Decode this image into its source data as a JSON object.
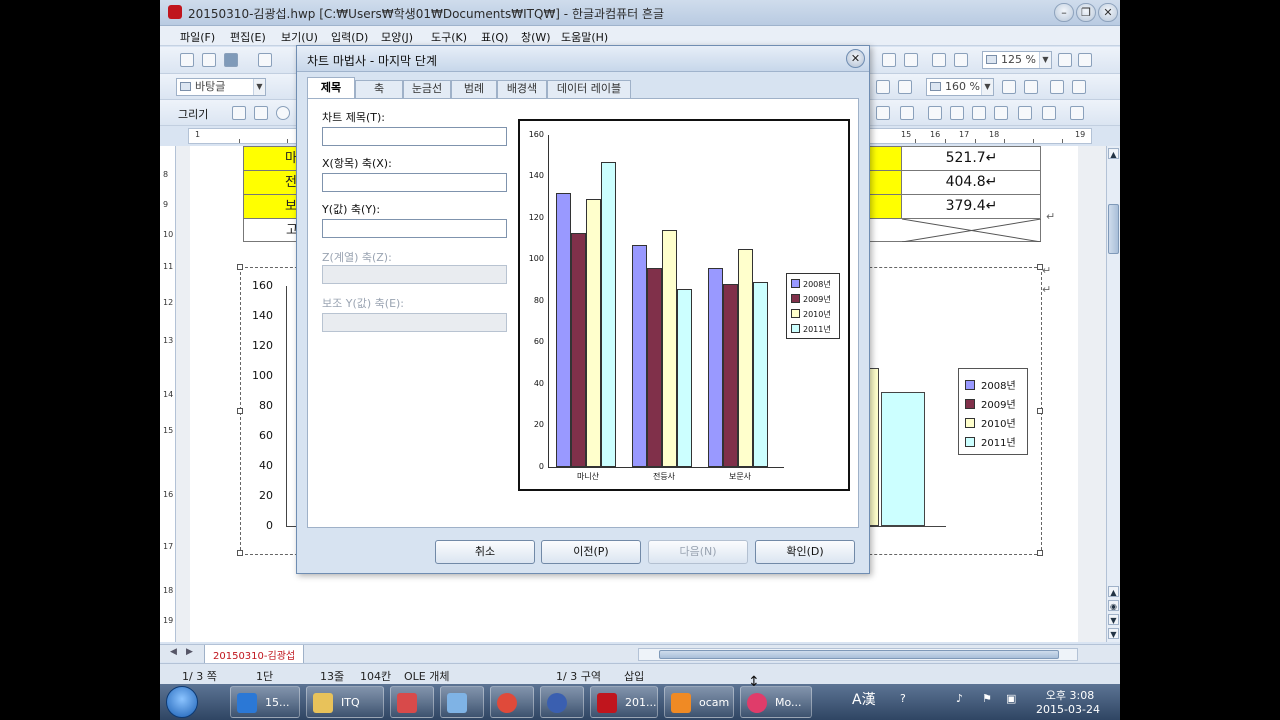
{
  "window": {
    "title": "20150310-김광섭.hwp [C:₩Users₩학생01₩Documents₩ITQ₩] - 한글과컴퓨터 흔글",
    "minimize": "–",
    "restore": "❐",
    "close": "✕"
  },
  "menu": [
    "파일(F)",
    "편집(E)",
    "보기(U)",
    "입력(D)",
    "모양(J)",
    "도구(K)",
    "표(Q)",
    "창(W)",
    "도움말(H)"
  ],
  "toolbar": {
    "zoom_value": "125 %",
    "style_value": "바탕글",
    "line_spacing_value": "160 %",
    "draw_label": "그리기"
  },
  "ruler_numbers": [
    "1",
    "15",
    "16",
    "17",
    "18",
    "19"
  ],
  "vruler_numbers": [
    "8",
    "9",
    "10",
    "11",
    "12",
    "13",
    "14",
    "15",
    "16",
    "17",
    "18",
    "19"
  ],
  "table": {
    "rows": [
      {
        "label": "마",
        "value": "521.7↵"
      },
      {
        "label": "전",
        "value": "404.8↵"
      },
      {
        "label": "보",
        "value": "379.4↵"
      },
      {
        "label": "고",
        "value": ""
      }
    ],
    "return_mark": "↵"
  },
  "background_chart": {
    "y_ticks": [
      "160",
      "140",
      "120",
      "100",
      "80",
      "60",
      "40",
      "20",
      "0"
    ],
    "legend": [
      "2008년",
      "2009년",
      "2010년",
      "2011년"
    ],
    "y_max": 160,
    "visible_bars": [
      {
        "series": "2010년",
        "value": 105
      },
      {
        "series": "2011년",
        "value": 89
      }
    ]
  },
  "dialog": {
    "title": "차트 마법사 - 마지막 단계",
    "tabs": [
      "제목",
      "축",
      "눈금선",
      "범례",
      "배경색",
      "데이터 레이블"
    ],
    "active_tab": "제목",
    "fields": [
      {
        "label": "차트 제목(T):",
        "value": "",
        "enabled": true
      },
      {
        "label": "X(항목) 축(X):",
        "value": "",
        "enabled": true
      },
      {
        "label": "Y(값) 축(Y):",
        "value": "",
        "enabled": true
      },
      {
        "label": "Z(계열) 축(Z):",
        "value": "",
        "enabled": false
      },
      {
        "label": "보조 Y(값) 축(E):",
        "value": "",
        "enabled": false
      }
    ],
    "buttons": {
      "cancel": "취소",
      "prev": "이전(P)",
      "next": "다음(N)",
      "ok": "확인(D)"
    },
    "close": "✕"
  },
  "chart_data": {
    "type": "bar",
    "categories": [
      "마니산",
      "전등사",
      "보문사"
    ],
    "series": [
      {
        "name": "2008년",
        "values": [
          132,
          107,
          96
        ]
      },
      {
        "name": "2009년",
        "values": [
          113,
          96,
          88
        ]
      },
      {
        "name": "2010년",
        "values": [
          129,
          114,
          105
        ]
      },
      {
        "name": "2011년",
        "values": [
          147,
          86,
          89
        ]
      }
    ],
    "y_ticks": [
      "160",
      "140",
      "120",
      "100",
      "80",
      "60",
      "40",
      "20",
      "0"
    ],
    "ylim": [
      0,
      160
    ],
    "legend_position": "right",
    "colors": [
      "#9999ff",
      "#80304a",
      "#ffffcc",
      "#ccffff"
    ]
  },
  "statusbar": {
    "page": "1/   3 쪽",
    "section": "1단",
    "line": "13줄",
    "column": "104칸",
    "object": "OLE 개체",
    "zone": "1/   3 구역",
    "mode": "삽입"
  },
  "doc_tab": "20150310-김광섭",
  "taskbar": {
    "items": [
      {
        "label": "15...",
        "icon": "internet-explorer-icon",
        "color": "#2b78d6"
      },
      {
        "label": "ITQ",
        "icon": "folder-icon",
        "color": "#e8c25a"
      },
      {
        "label": "",
        "icon": "paint-tool-icon",
        "color": "#d84a4a"
      },
      {
        "label": "",
        "icon": "notepad-icon",
        "color": "#7fb3e5"
      },
      {
        "label": "",
        "icon": "chrome-icon",
        "color": "#e04a3a"
      },
      {
        "label": "",
        "icon": "app-s-icon",
        "color": "#3a5fb0"
      },
      {
        "label": "201...",
        "icon": "hwp-icon",
        "color": "#c0151d"
      },
      {
        "label": "ocam",
        "icon": "ocam-icon",
        "color": "#f08a24"
      },
      {
        "label": "Mo...",
        "icon": "movie-maker-icon",
        "color": "#e03c6a"
      }
    ],
    "ime": "A漢",
    "time": "오후 3:08",
    "date": "2015-03-24"
  }
}
